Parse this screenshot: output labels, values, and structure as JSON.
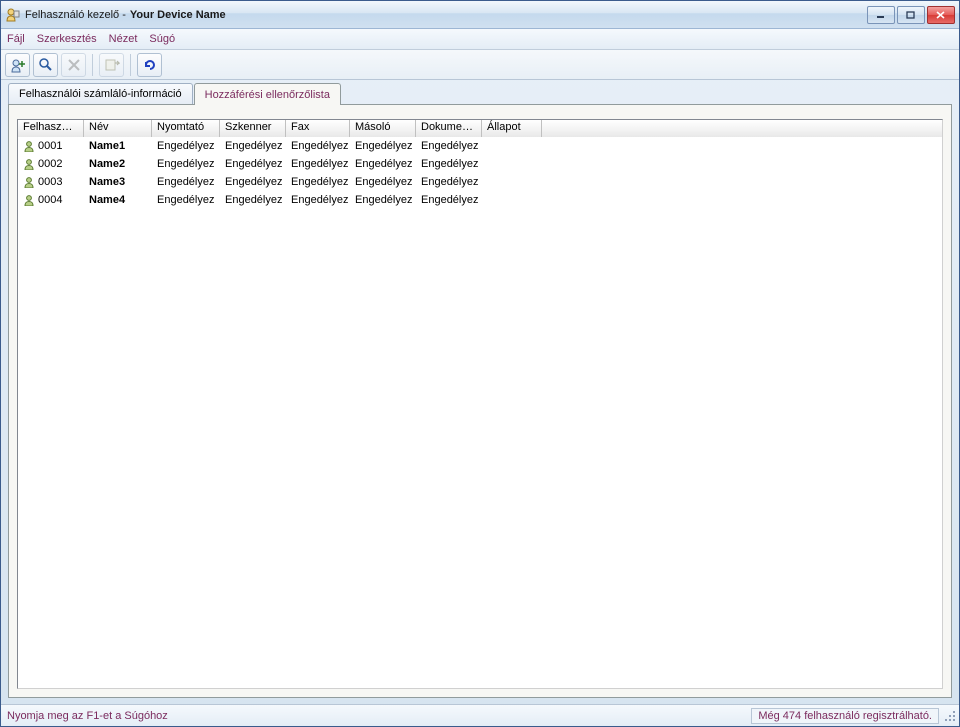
{
  "title": {
    "app": "Felhasználó kezelő -",
    "device": "Your Device Name"
  },
  "menu": {
    "file": "Fájl",
    "edit": "Szerkesztés",
    "view": "Nézet",
    "help": "Súgó"
  },
  "tabs": {
    "counter": "Felhasználói számláló-információ",
    "access": "Hozzáférési ellenőrzőlista"
  },
  "columns": {
    "user": "Felhasználó",
    "name": "Név",
    "printer": "Nyomtató",
    "scanner": "Szkenner",
    "fax": "Fax",
    "copier": "Másoló",
    "doc": "Dokumen...",
    "status": "Állapot"
  },
  "rows": [
    {
      "id": "0001",
      "name": "Name1",
      "printer": "Engedélyez",
      "scanner": "Engedélyez",
      "fax": "Engedélyez",
      "copier": "Engedélyez",
      "doc": "Engedélyez",
      "status": ""
    },
    {
      "id": "0002",
      "name": "Name2",
      "printer": "Engedélyez",
      "scanner": "Engedélyez",
      "fax": "Engedélyez",
      "copier": "Engedélyez",
      "doc": "Engedélyez",
      "status": ""
    },
    {
      "id": "0003",
      "name": "Name3",
      "printer": "Engedélyez",
      "scanner": "Engedélyez",
      "fax": "Engedélyez",
      "copier": "Engedélyez",
      "doc": "Engedélyez",
      "status": ""
    },
    {
      "id": "0004",
      "name": "Name4",
      "printer": "Engedélyez",
      "scanner": "Engedélyez",
      "fax": "Engedélyez",
      "copier": "Engedélyez",
      "doc": "Engedélyez",
      "status": ""
    }
  ],
  "status": {
    "hint": "Nyomja meg az F1-et a Súgóhoz",
    "remaining": "Még 474 felhasználó regisztrálható."
  }
}
